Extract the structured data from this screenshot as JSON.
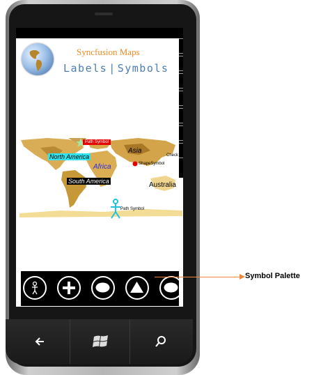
{
  "app": {
    "title": "Syncfusion Maps",
    "nav": {
      "labels": "Labels",
      "separator": "|",
      "symbols": "Symbols"
    }
  },
  "map": {
    "labels": {
      "north_america": "North America",
      "south_america": "South America",
      "africa": "Africa",
      "asia": "Asia",
      "australia": "Australia",
      "checked": "Check"
    },
    "symbols": {
      "path_symbol_top": "Path Symbol",
      "shape_symbol": "ShapeSymbol",
      "path_symbol_bottom": "Path Symbol"
    },
    "colors": {
      "land": "#e8c36b",
      "land_dark": "#c99a3a",
      "land_light": "#f3dc96",
      "na_label_bg": "#2fe3ee",
      "sa_label_bg": "#000000",
      "path_symbol_bg": "#e60000",
      "shape_symbol_dot": "#e60000",
      "person_symbol": "#1ec3e0"
    }
  },
  "palette": {
    "buttons": [
      {
        "icon": "person-icon"
      },
      {
        "icon": "plus-icon"
      },
      {
        "icon": "ellipse-icon"
      },
      {
        "icon": "triangle-icon"
      },
      {
        "icon": "ellipse-icon"
      }
    ]
  },
  "hardware": {
    "back": "back-icon",
    "start": "windows-icon",
    "search": "search-icon"
  },
  "annotation": {
    "text": "Symbol Palette",
    "color": "#f0883a"
  }
}
